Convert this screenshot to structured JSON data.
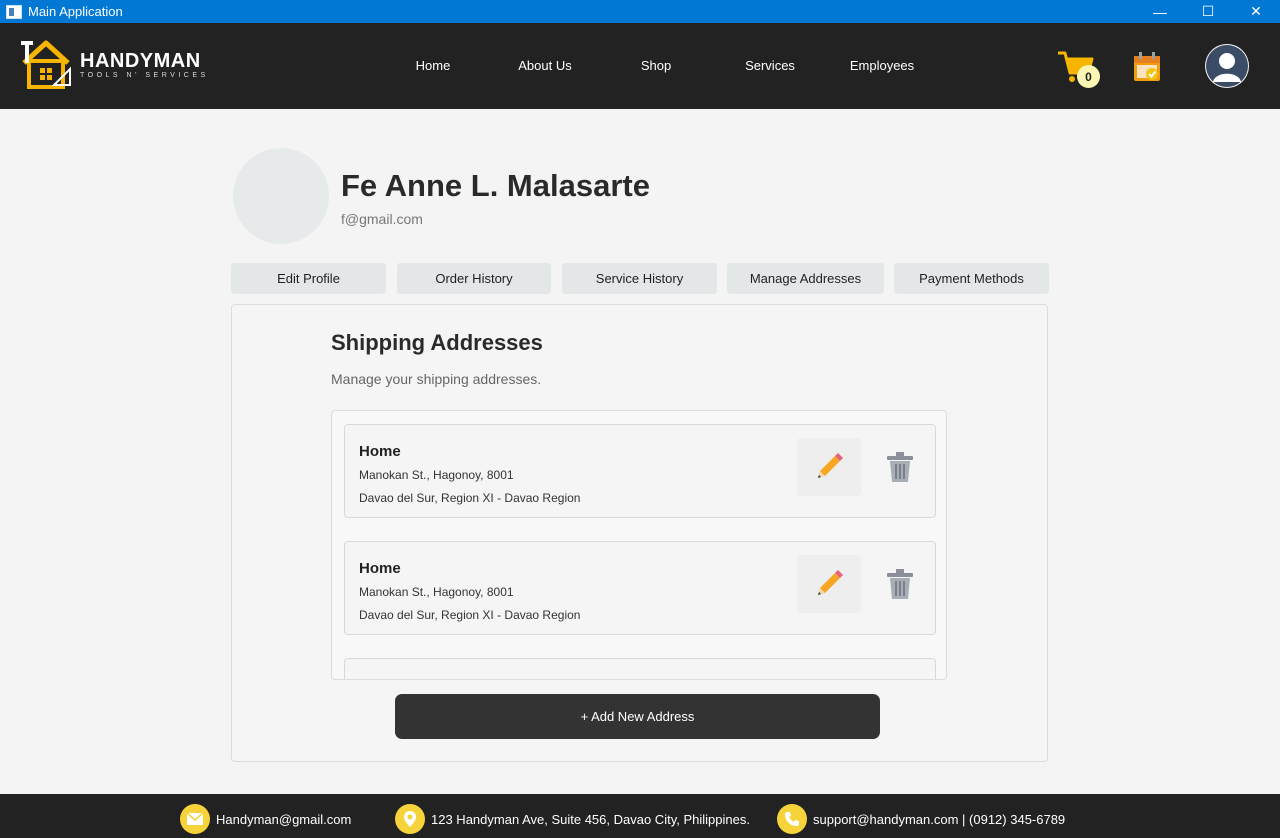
{
  "window": {
    "title": "Main Application",
    "minimize": "—",
    "maximize": "☐",
    "close": "✕"
  },
  "brand": {
    "name": "HANDYMAN",
    "tagline": "TOOLS N' SERVICES"
  },
  "nav": {
    "home": "Home",
    "about": "About Us",
    "shop": "Shop",
    "services": "Services",
    "employees": "Employees"
  },
  "cart": {
    "count": "0"
  },
  "profile": {
    "name": "Fe Anne L. Malasarte",
    "email": "f@gmail.com"
  },
  "tabs": {
    "edit_profile": "Edit Profile",
    "order_history": "Order History",
    "service_history": "Service History",
    "manage_addresses": "Manage Addresses",
    "payment_methods": "Payment Methods"
  },
  "addresses_panel": {
    "title": "Shipping Addresses",
    "subtitle": "Manage your shipping addresses.",
    "items": [
      {
        "label": "Home",
        "line1": "Manokan St., Hagonoy, 8001",
        "line2": "Davao del Sur, Region XI - Davao Region"
      },
      {
        "label": "Home",
        "line1": "Manokan St., Hagonoy, 8001",
        "line2": "Davao del Sur, Region XI - Davao Region"
      }
    ],
    "add_button": "+ Add New Address"
  },
  "footer": {
    "email": "Handyman@gmail.com",
    "address": "123 Handyman Ave, Suite 456, Davao City, Philippines.",
    "support": "support@handyman.com | (0912) 345-6789"
  },
  "colors": {
    "titlebar": "#0078d4",
    "header": "#222222",
    "accent": "#f7b500",
    "button_dark": "#333333"
  }
}
